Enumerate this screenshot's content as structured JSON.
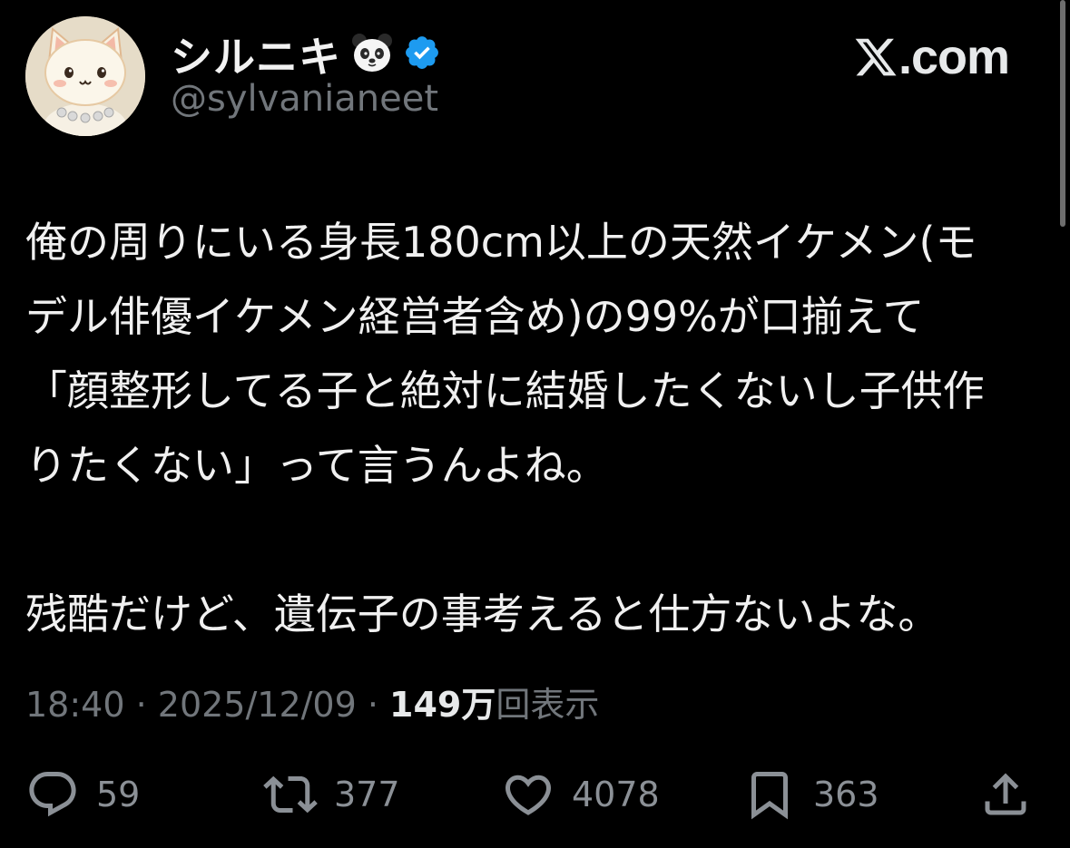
{
  "user": {
    "display_name": "シルニキ",
    "name_emoji_icon": "panda-face-icon",
    "verified_icon": "verified-badge-icon",
    "verified_color": "#1d9bf0",
    "handle": "@sylvanianeet",
    "avatar_icon": "cat-avatar-icon"
  },
  "brand": {
    "icon": "x-logo-icon",
    "domain_text": ".com"
  },
  "tweet": {
    "lines": [
      "俺の周りにいる身長180cm以上の天然イケメン(モ",
      "デル俳優イケメン経営者含め)の99%が口揃えて",
      "「顔整形してる子と絶対に結婚したくないし子供作",
      "りたくない」って言うんよね。"
    ],
    "lines2": [
      "残酷だけど、遺伝子の事考えると仕方ないよな。"
    ]
  },
  "meta": {
    "time": "18:40",
    "separator": " · ",
    "date": "2025/12/09",
    "views_count": "149万",
    "views_label": "回表示"
  },
  "actions": {
    "reply": {
      "icon": "reply-icon",
      "count": "59"
    },
    "retweet": {
      "icon": "retweet-icon",
      "count": "377"
    },
    "like": {
      "icon": "heart-icon",
      "count": "4078"
    },
    "bookmark": {
      "icon": "bookmark-icon",
      "count": "363"
    },
    "share": {
      "icon": "share-icon"
    }
  },
  "colors": {
    "background": "#000000",
    "text": "#e7e9ea",
    "secondary": "#71767b"
  }
}
